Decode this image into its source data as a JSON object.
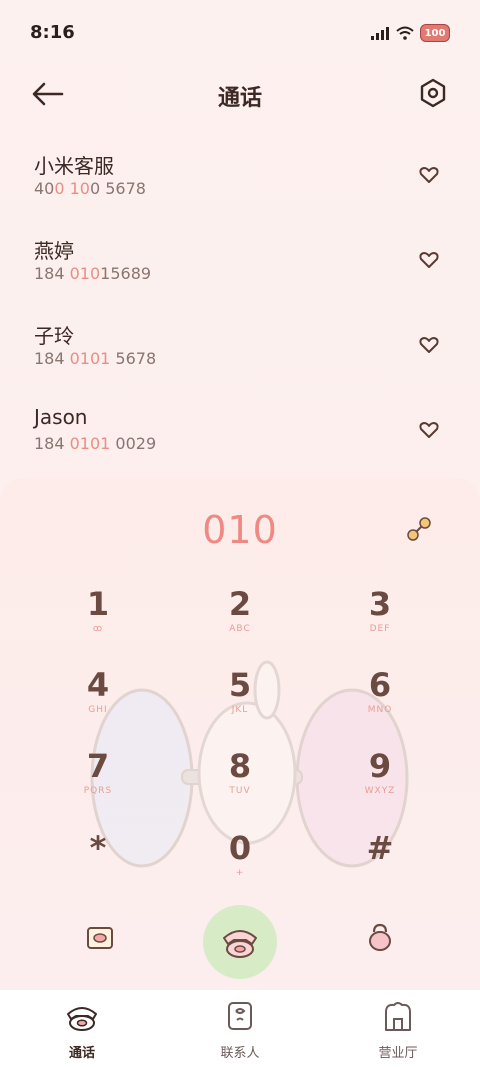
{
  "status": {
    "time": "8:16",
    "battery": "100"
  },
  "header": {
    "title": "通话",
    "back_icon": "arrow-left-icon",
    "settings_icon": "hexagon-settings-icon"
  },
  "contacts": [
    {
      "name": "小米客服",
      "num_parts": [
        "40",
        "0 10",
        "0 5678"
      ]
    },
    {
      "name": "燕婷",
      "num_parts": [
        "184 ",
        "010",
        "15689"
      ]
    },
    {
      "name": "子玲",
      "num_parts": [
        "184 ",
        "0101",
        " 5678"
      ]
    },
    {
      "name": "Jason",
      "num_parts": [
        "184 ",
        "0101",
        " 0029"
      ]
    }
  ],
  "dialpad": {
    "dialed": "010",
    "keys": [
      {
        "digit": "1",
        "letters": "ꝏ"
      },
      {
        "digit": "2",
        "letters": "ABC"
      },
      {
        "digit": "3",
        "letters": "DEF"
      },
      {
        "digit": "4",
        "letters": "GHI"
      },
      {
        "digit": "5",
        "letters": "JKL"
      },
      {
        "digit": "6",
        "letters": "MNO"
      },
      {
        "digit": "7",
        "letters": "PQRS"
      },
      {
        "digit": "8",
        "letters": "TUV"
      },
      {
        "digit": "9",
        "letters": "WXYZ"
      },
      {
        "digit": "*",
        "letters": ""
      },
      {
        "digit": "0",
        "letters": "+"
      },
      {
        "digit": "#",
        "letters": ""
      }
    ]
  },
  "tabs": [
    {
      "label": "通话",
      "icon": "phone-tab-icon",
      "active": true
    },
    {
      "label": "联系人",
      "icon": "contacts-tab-icon",
      "active": false
    },
    {
      "label": "营业厅",
      "icon": "store-tab-icon",
      "active": false
    }
  ],
  "colors": {
    "accent": "#ef8a83",
    "call_button": "#d7ecc6",
    "text": "#3c2824"
  }
}
